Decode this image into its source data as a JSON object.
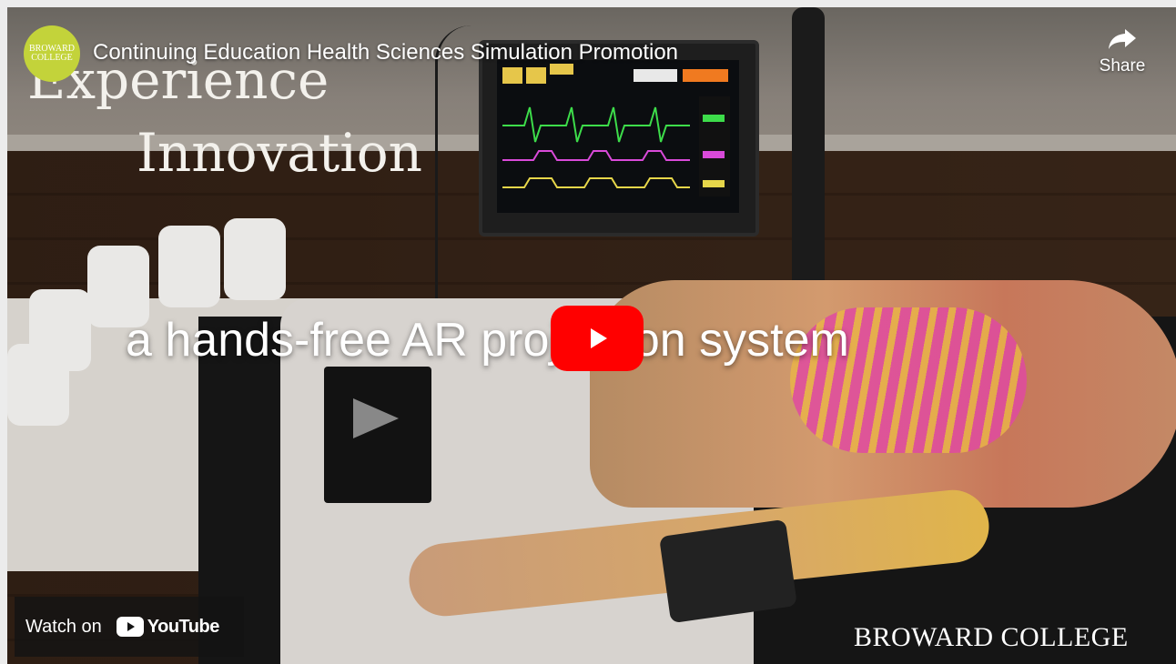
{
  "video": {
    "title": "Continuing Education Health Sciences Simulation Promotion",
    "channel_logo_text": [
      "BROWARD",
      "COLLEGE"
    ],
    "share_label": "Share",
    "play_button_label": "Play",
    "watch_on_label": "Watch on",
    "youtube_label": "YouTube"
  },
  "frame": {
    "headline_line1": "Experience",
    "headline_line2": "Innovation",
    "caption": "a hands-free AR projection system",
    "brand_watermark": "BROWARD COLLEGE"
  },
  "icons": {
    "share": "share-arrow-icon",
    "play": "play-icon",
    "youtube": "youtube-logo-icon"
  },
  "colors": {
    "play_button": "#ff0000",
    "logo_bg": "#c3d33a"
  }
}
